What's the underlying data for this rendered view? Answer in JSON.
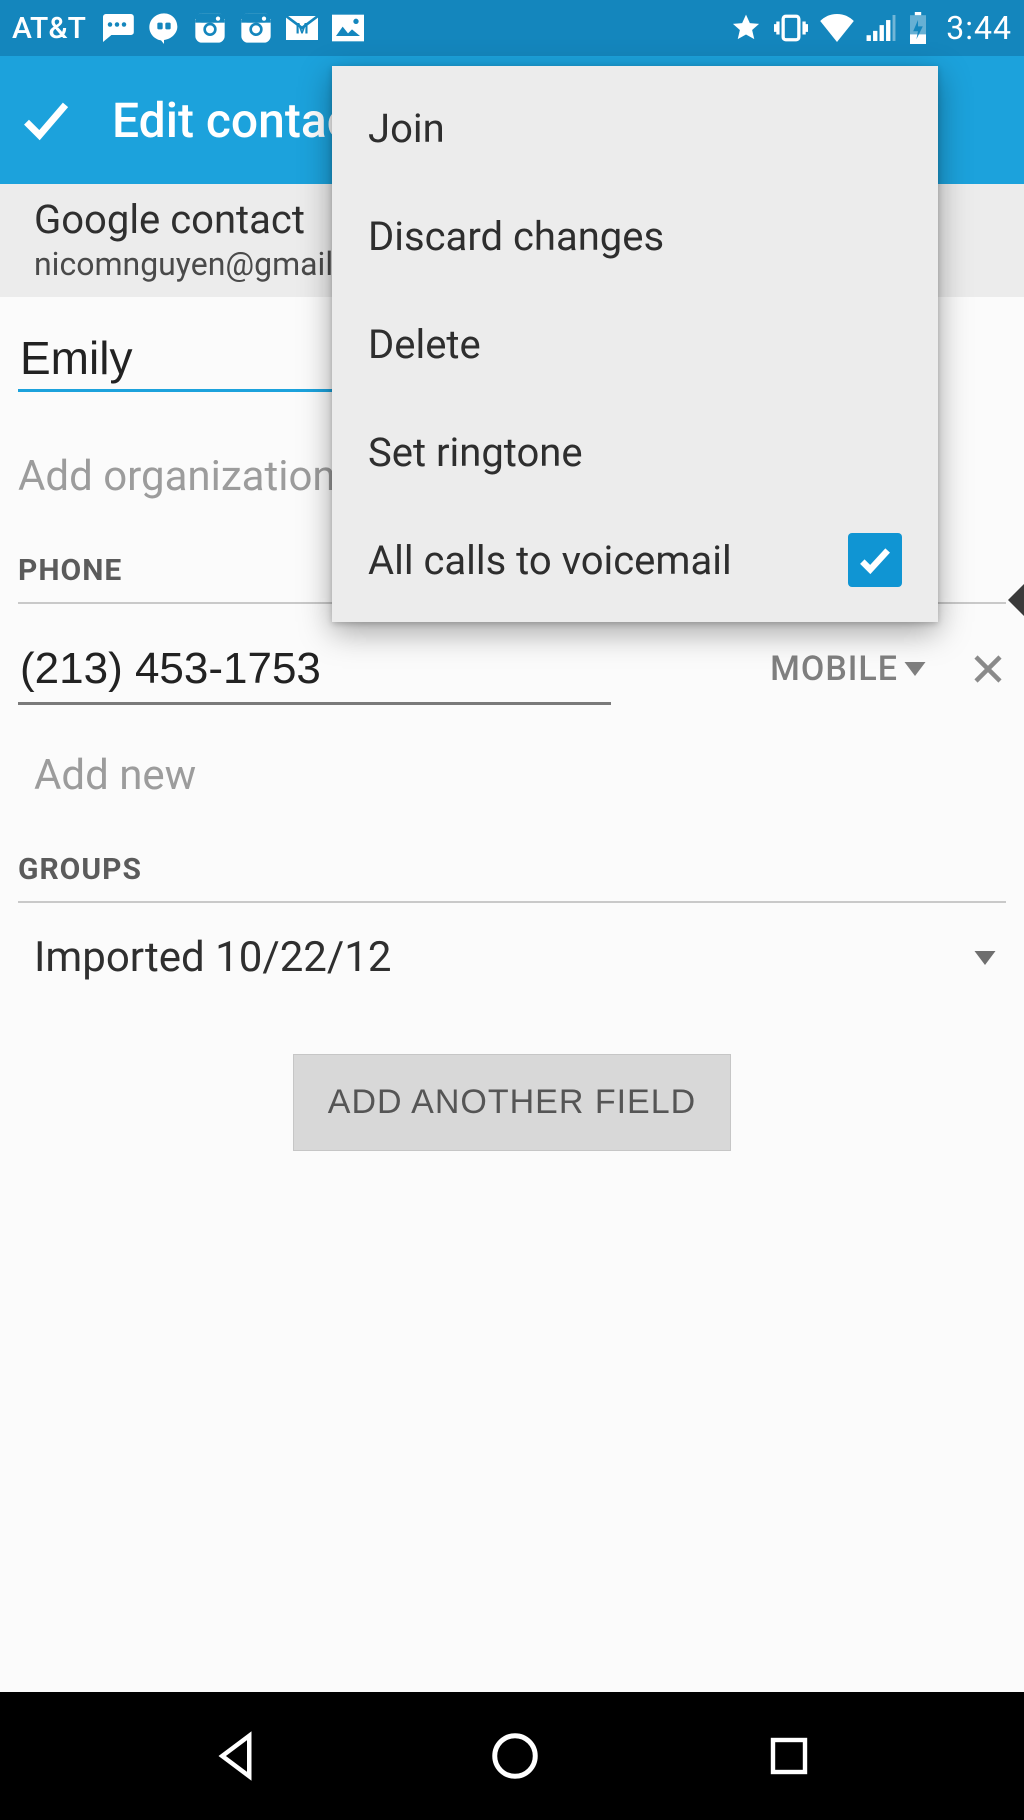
{
  "status": {
    "carrier": "AT&T",
    "time": "3:44"
  },
  "header": {
    "title": "Edit contact"
  },
  "account": {
    "type_label": "Google contact",
    "email": "nicomnguyen@gmail.com"
  },
  "name": {
    "value": "Emily"
  },
  "organization": {
    "placeholder": "Add organization"
  },
  "sections": {
    "phone_label": "PHONE",
    "groups_label": "GROUPS"
  },
  "phone": {
    "number": "(213) 453-1753",
    "type": "MOBILE",
    "add_new": "Add new"
  },
  "groups": {
    "value": "Imported 10/22/12"
  },
  "buttons": {
    "add_field": "ADD ANOTHER FIELD"
  },
  "menu": {
    "items": [
      {
        "label": "Join"
      },
      {
        "label": "Discard changes"
      },
      {
        "label": "Delete"
      },
      {
        "label": "Set ringtone"
      },
      {
        "label": "All calls to voicemail",
        "checked": true
      }
    ]
  }
}
